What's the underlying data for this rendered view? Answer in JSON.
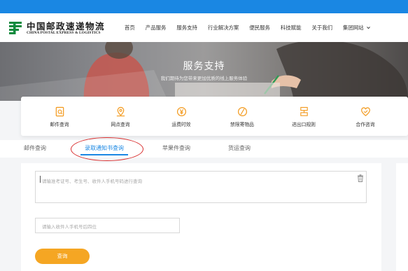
{
  "brand": {
    "name_cn": "中国邮政速递物流",
    "name_en": "CHINA POSTAL EXPRESS & LOGISTICS",
    "logo_icon": "china-post-logo-icon"
  },
  "nav": {
    "items": [
      "首页",
      "产品服务",
      "服务支持",
      "行业解决方案",
      "便民服务",
      "科技赋能",
      "关于我们"
    ],
    "group_site": "集团网站"
  },
  "hero": {
    "title": "服务支持",
    "subtitle": "我们期待为您带来更加优质的线上服务体验"
  },
  "services": [
    {
      "label": "邮件查询",
      "icon": "mail-search-icon"
    },
    {
      "label": "网点查询",
      "icon": "location-pin-icon"
    },
    {
      "label": "运费时效",
      "icon": "yen-coin-icon"
    },
    {
      "label": "禁限寄物品",
      "icon": "prohibited-icon"
    },
    {
      "label": "进出口规则",
      "icon": "customs-rules-icon"
    },
    {
      "label": "合作咨询",
      "icon": "handshake-heart-icon"
    }
  ],
  "tabs": [
    "邮件查询",
    "录取通知书查询",
    "苹果件查询",
    "货运查询"
  ],
  "active_tab": "录取通知书查询",
  "form": {
    "textarea_placeholder": "请输准考证号、考生号、收件人手机号码进行查询",
    "phone_placeholder": "请输入收件人手机号后四位",
    "query_button": "查询"
  },
  "colors": {
    "primary_blue": "#1a87e3",
    "accent_orange": "#f5a623",
    "annotation_red": "#d93030"
  }
}
